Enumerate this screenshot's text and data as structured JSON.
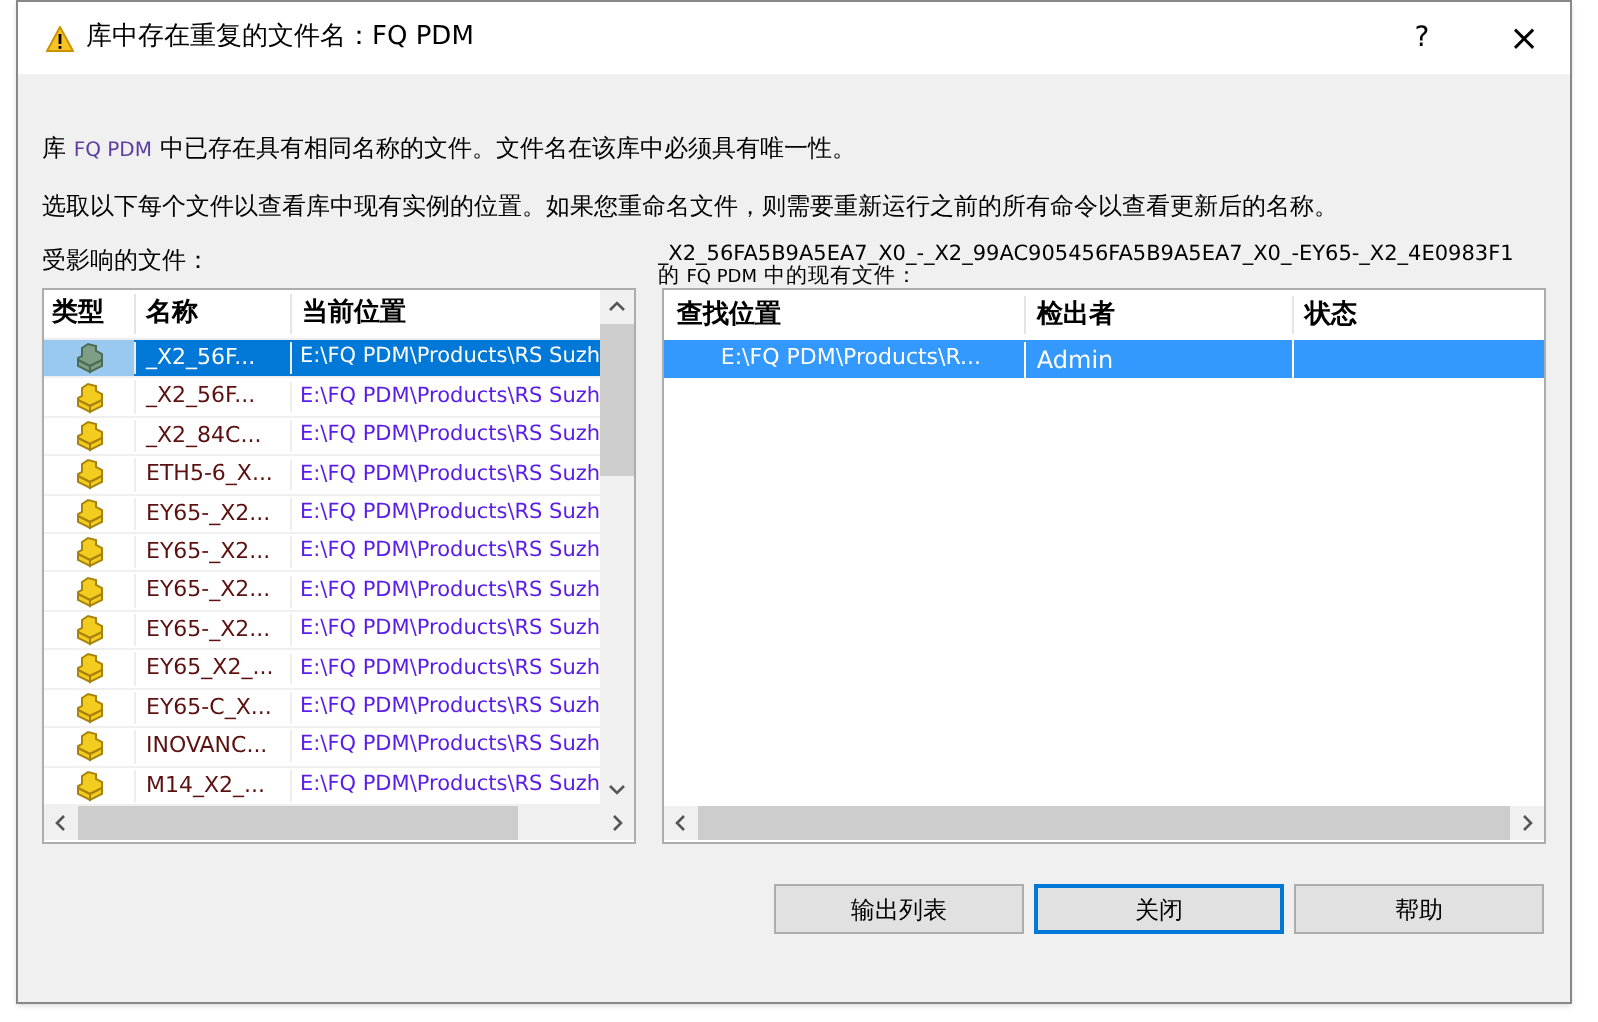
{
  "window": {
    "title": "库中存在重复的文件名：FQ PDM",
    "help": "?",
    "close": "×"
  },
  "message": {
    "prefix": "库",
    "vault": "FQ PDM",
    "suffix": "中已存在具有相同名称的文件。文件名在该库中必须具有唯一性。"
  },
  "instruction": "选取以下每个文件以查看库中现有实例的位置。如果您重命名文件，则需要重新运行之前的所有命令以查看更新后的名称。",
  "affected_label": "受影响的文件：",
  "existing_label": {
    "file": "_X2_56FA5B9A5EA7_X0_-_X2_99AC905456FA5B9A5EA7_X0_-EY65-_X2_4E0983F1",
    "prefix": "的",
    "vault": "FQ PDM",
    "suffix": "中的现有文件："
  },
  "files": {
    "columns": [
      "类型",
      "名称",
      "当前位置"
    ],
    "rows": [
      {
        "name": "_X2_56F...",
        "location": "E:\\FQ PDM\\Products\\RS Suzh",
        "selected": true
      },
      {
        "name": "_X2_56F...",
        "location": "E:\\FQ PDM\\Products\\RS Suzh",
        "selected": false
      },
      {
        "name": "_X2_84C...",
        "location": "E:\\FQ PDM\\Products\\RS Suzh",
        "selected": false
      },
      {
        "name": "ETH5-6_X...",
        "location": "E:\\FQ PDM\\Products\\RS Suzh",
        "selected": false
      },
      {
        "name": "EY65-_X2...",
        "location": "E:\\FQ PDM\\Products\\RS Suzh",
        "selected": false
      },
      {
        "name": "EY65-_X2...",
        "location": "E:\\FQ PDM\\Products\\RS Suzh",
        "selected": false
      },
      {
        "name": "EY65-_X2...",
        "location": "E:\\FQ PDM\\Products\\RS Suzh",
        "selected": false
      },
      {
        "name": "EY65-_X2...",
        "location": "E:\\FQ PDM\\Products\\RS Suzh",
        "selected": false
      },
      {
        "name": "EY65_X2_...",
        "location": "E:\\FQ PDM\\Products\\RS Suzh",
        "selected": false
      },
      {
        "name": "EY65-C_X...",
        "location": "E:\\FQ PDM\\Products\\RS Suzh",
        "selected": false
      },
      {
        "name": "INOVANC...",
        "location": "E:\\FQ PDM\\Products\\RS Suzh",
        "selected": false
      },
      {
        "name": "M14_X2_...",
        "location": "E:\\FQ PDM\\Products\\RS Suzh",
        "selected": false
      }
    ]
  },
  "existing": {
    "columns": [
      "查找位置",
      "检出者",
      "状态"
    ],
    "rows": [
      {
        "location": "E:\\FQ PDM\\Products\\R...",
        "checked_out_by": "Admin",
        "selected": true
      }
    ]
  },
  "buttons": [
    {
      "label": "输出列表",
      "focused": false
    },
    {
      "label": "关闭",
      "focused": true
    },
    {
      "label": "帮助",
      "focused": false
    }
  ]
}
